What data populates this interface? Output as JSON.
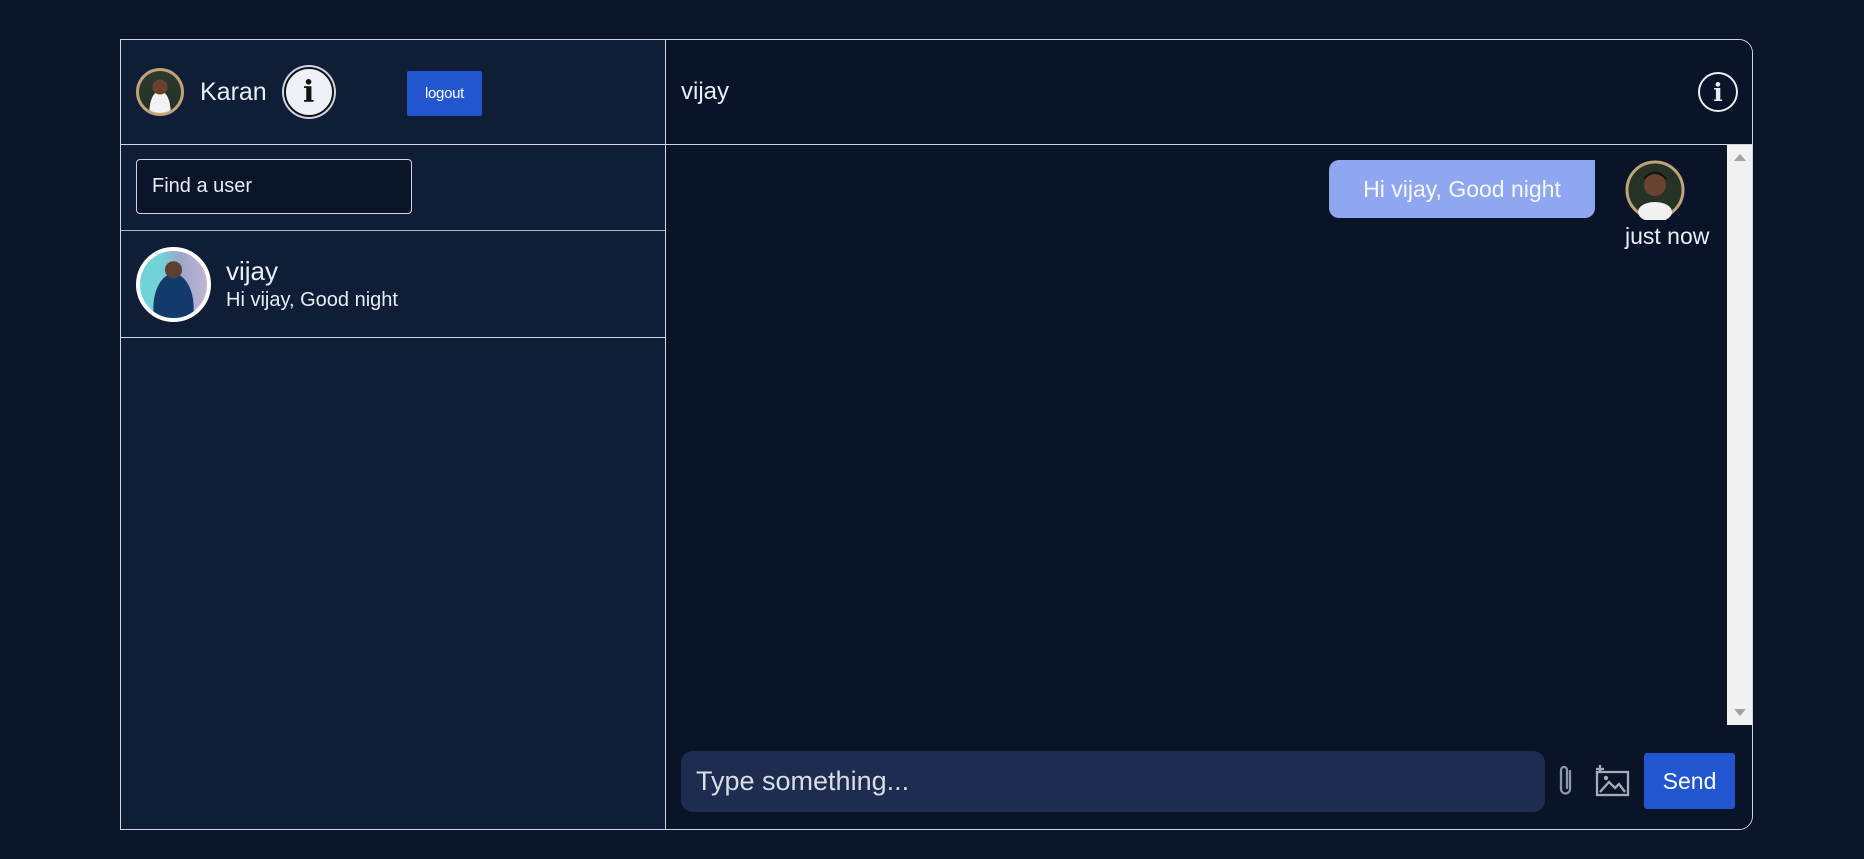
{
  "sidebar": {
    "user": {
      "name": "Karan",
      "avatar": "user-avatar"
    },
    "info_icon": "info-icon",
    "logout_label": "logout",
    "search": {
      "placeholder": "Find a user",
      "value": ""
    },
    "chats": [
      {
        "name": "vijay",
        "last_message": "Hi vijay, Good night"
      }
    ]
  },
  "chat": {
    "title": "vijay",
    "info_icon": "info-icon",
    "messages": [
      {
        "text": "Hi vijay, Good night",
        "time": "just now",
        "from": "Karan"
      }
    ]
  },
  "composer": {
    "placeholder": "Type something...",
    "value": "",
    "attach_icon": "paperclip-icon",
    "image_icon": "add-image-icon",
    "send_label": "Send"
  },
  "colors": {
    "page_bg": "#0b1529",
    "sidebar_bg": "#0f1d37",
    "main_bg": "#0a1428",
    "accent": "#2256d1",
    "bubble": "#8fa6f0",
    "input_bg": "#1e2d4f"
  }
}
